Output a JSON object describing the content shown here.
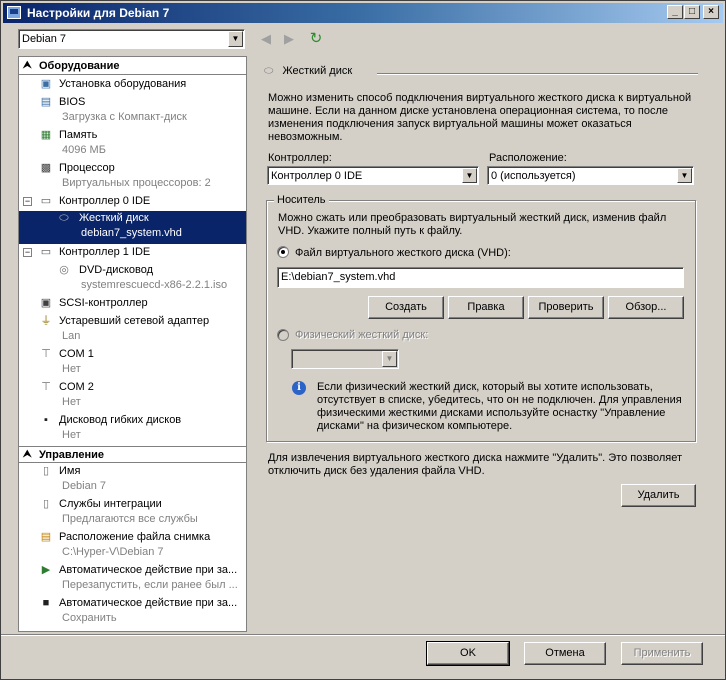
{
  "window": {
    "title": "Настройки для Debian 7"
  },
  "toolbar": {
    "vm_selector": "Debian 7"
  },
  "tree": {
    "hardware_header": "Оборудование",
    "management_header": "Управление",
    "items": [
      {
        "icon": "add-hardware-icon",
        "label": "Установка оборудования",
        "sub": ""
      },
      {
        "icon": "bios-icon",
        "label": "BIOS",
        "sub": "Загрузка с Компакт-диск"
      },
      {
        "icon": "memory-icon",
        "label": "Память",
        "sub": "4096 МБ"
      },
      {
        "icon": "processor-icon",
        "label": "Процессор",
        "sub": "Виртуальных процессоров: 2"
      },
      {
        "icon": "ide-controller-icon",
        "label": "Контроллер 0 IDE",
        "sub": ""
      },
      {
        "icon": "hard-disk-icon",
        "label": "Жесткий диск",
        "sub": "debian7_system.vhd"
      },
      {
        "icon": "ide-controller-icon",
        "label": "Контроллер 1 IDE",
        "sub": ""
      },
      {
        "icon": "dvd-icon",
        "label": "DVD-дисковод",
        "sub": "systemrescuecd-x86-2.2.1.iso"
      },
      {
        "icon": "scsi-icon",
        "label": "SCSI-контроллер",
        "sub": ""
      },
      {
        "icon": "network-adapter-icon",
        "label": "Устаревший сетевой адаптер",
        "sub": "Lan"
      },
      {
        "icon": "com-port-icon",
        "label": "COM 1",
        "sub": "Нет"
      },
      {
        "icon": "com-port-icon",
        "label": "COM 2",
        "sub": "Нет"
      },
      {
        "icon": "floppy-icon",
        "label": "Дисковод гибких дисков",
        "sub": "Нет"
      },
      {
        "icon": "name-icon",
        "label": "Имя",
        "sub": "Debian 7"
      },
      {
        "icon": "integration-services-icon",
        "label": "Службы интеграции",
        "sub": "Предлагаются все службы"
      },
      {
        "icon": "snapshot-location-icon",
        "label": "Расположение файла снимка",
        "sub": "C:\\Hyper-V\\Debian 7"
      },
      {
        "icon": "auto-start-icon",
        "label": "Автоматическое действие при за...",
        "sub": "Перезапустить, если ранее был ..."
      },
      {
        "icon": "auto-stop-icon",
        "label": "Автоматическое действие при за...",
        "sub": "Сохранить"
      }
    ]
  },
  "panel": {
    "header": "Жесткий диск",
    "description": "Можно изменить способ подключения виртуального жесткого диска к виртуальной машине. Если на данном диске установлена операционная система, то после изменения подключения запуск виртуальной машины может оказаться невозможным.",
    "controller_label": "Контроллер:",
    "controller_value": "Контроллер 0 IDE",
    "location_label": "Расположение:",
    "location_value": "0 (используется)",
    "media_group": "Носитель",
    "media_desc": "Можно сжать или преобразовать виртуальный жесткий диск, изменив файл VHD. Укажите полный путь к файлу.",
    "vhd_radio": "Файл виртуального жесткого диска (VHD):",
    "vhd_path": "E:\\debian7_system.vhd",
    "btn_create": "Создать",
    "btn_edit": "Правка",
    "btn_inspect": "Проверить",
    "btn_browse": "Обзор...",
    "physical_radio": "Физический жесткий диск:",
    "physical_value": "",
    "info_text": "Если физический жесткий диск, который вы хотите использовать, отсутствует в списке, убедитесь, что он не подключен. Для управления физическими жесткими дисками используйте оснастку \"Управление дисками\" на физическом компьютере.",
    "remove_text": "Для извлечения виртуального жесткого диска нажмите \"Удалить\". Это позволяет отключить диск без удаления файла VHD.",
    "btn_remove": "Удалить"
  },
  "footer": {
    "ok": "OK",
    "cancel": "Отмена",
    "apply": "Применить"
  }
}
